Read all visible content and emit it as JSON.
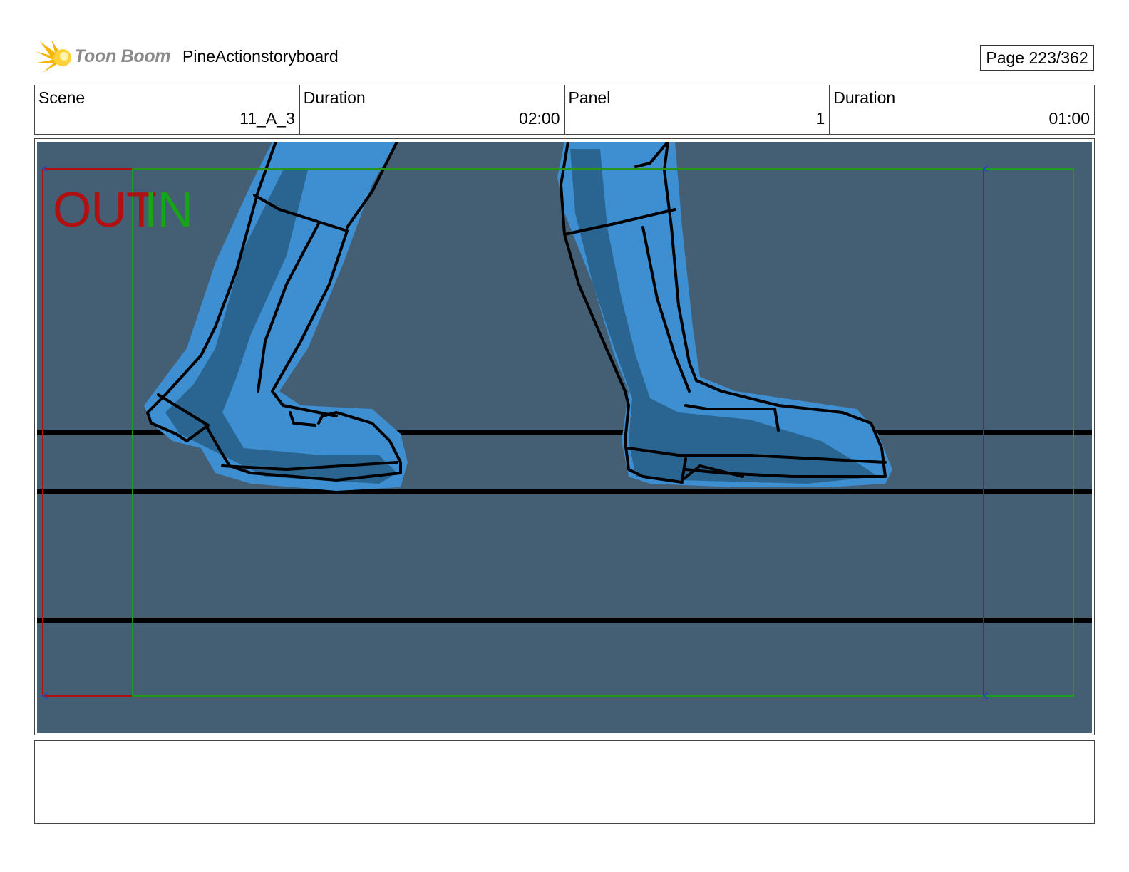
{
  "header": {
    "logo_text": "Toon Boom",
    "project_title": "PineActionstoryboard",
    "page_label": "Page 223/362"
  },
  "info": [
    {
      "label": "Scene",
      "value": "11_A_3"
    },
    {
      "label": "Duration",
      "value": "02:00"
    },
    {
      "label": "Panel",
      "value": "1"
    },
    {
      "label": "Duration",
      "value": "01:00"
    }
  ],
  "panel": {
    "out_label": "OUT",
    "in_label": "IN",
    "background_color": "#445e73",
    "figure_color": "#3d8fd1",
    "figure_shadow_color": "#2a6592",
    "out_frame_color": "#b01010",
    "in_frame_color": "#18a418"
  },
  "notes": {
    "text": ""
  }
}
